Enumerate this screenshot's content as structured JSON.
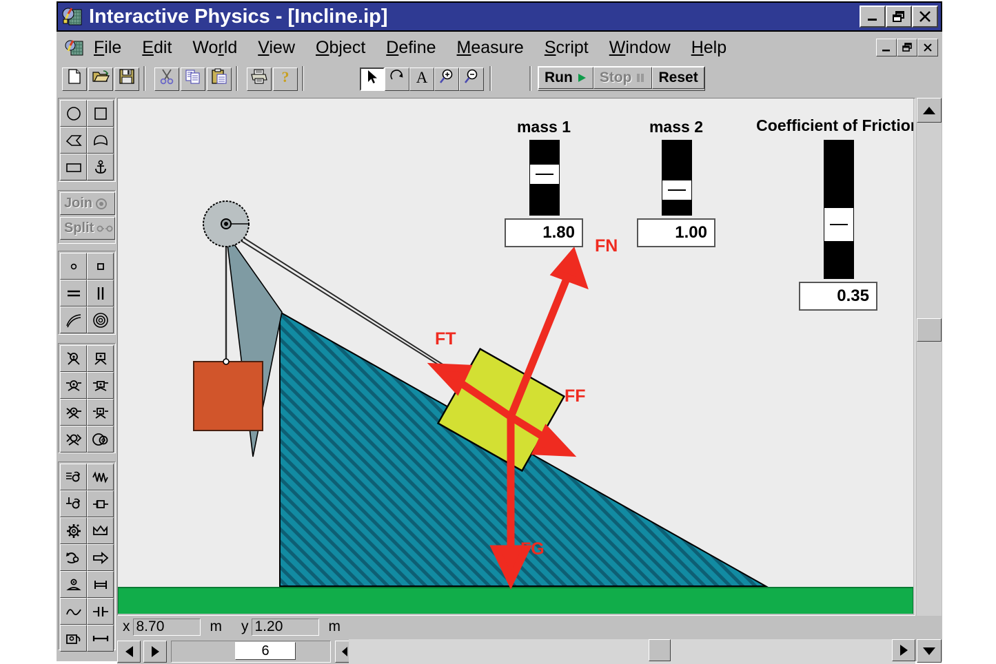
{
  "window": {
    "title": "Interactive Physics - [Incline.ip]",
    "app_icon": "physics-app-icon",
    "buttons": {
      "minimize": "_",
      "restore": "❐",
      "close": "✕"
    }
  },
  "mdi": {
    "minimize": "_",
    "restore": "❐",
    "close": "✕"
  },
  "menu": [
    {
      "label": "File",
      "accel": "F"
    },
    {
      "label": "Edit",
      "accel": "E"
    },
    {
      "label": "World",
      "accel": "r"
    },
    {
      "label": "View",
      "accel": "V"
    },
    {
      "label": "Object",
      "accel": "O"
    },
    {
      "label": "Define",
      "accel": "D"
    },
    {
      "label": "Measure",
      "accel": "M"
    },
    {
      "label": "Script",
      "accel": "S"
    },
    {
      "label": "Window",
      "accel": "W"
    },
    {
      "label": "Help",
      "accel": "H"
    }
  ],
  "toolbar": {
    "file_group": [
      "new-icon",
      "open-icon",
      "save-icon"
    ],
    "edit_group": [
      "cut-icon",
      "copy-icon",
      "paste-icon"
    ],
    "print_group": [
      "print-icon",
      "help-icon"
    ],
    "mode_group": [
      "arrow-pointer-icon",
      "rotate-icon",
      "text-icon",
      "zoom-in-icon",
      "zoom-out-icon"
    ],
    "run_label": "Run",
    "stop_label": "Stop",
    "reset_label": "Reset",
    "run_state": "enabled",
    "stop_state": "disabled"
  },
  "palette": {
    "shapes": [
      "circle-tool-icon",
      "rectangle-tool-icon",
      "polygon-tool-icon",
      "curved-polygon-tool-icon",
      "square-body-tool-icon",
      "anchor-tool-icon"
    ],
    "join_label": "Join",
    "split_label": "Split",
    "constraints": [
      "point-element-icon",
      "square-element-icon",
      "rod-icon",
      "rope-icon",
      "spring-curve-icon",
      "pulley-icon"
    ],
    "joints": [
      "pin-joint-icon",
      "rigid-joint-icon",
      "slot-joint-icon",
      "keyed-slot-joint-icon",
      "pin-slot-icon",
      "curved-slot-icon",
      "slot-rigid-icon",
      "gear-mesh-icon"
    ],
    "forces": [
      "damper-icon",
      "spring-zigzag-icon",
      "rotational-damper-icon",
      "actuator-icon",
      "motor-icon",
      "separator-icon",
      "force-curve-icon",
      "force-arrow-icon",
      "torque-icon",
      "rod-constraint-icon",
      "wave-icon",
      "capacitor-icon",
      "meter-icon",
      "ruler-icon"
    ]
  },
  "simulation": {
    "controls": [
      {
        "name": "mass 1",
        "value": "1.80",
        "fill_ratio": 0.4
      },
      {
        "name": "mass 2",
        "value": "1.00",
        "fill_ratio": 0.7
      },
      {
        "name": "Coefficient of Friction",
        "value": "0.35",
        "fill_ratio": 0.52
      }
    ],
    "force_labels": [
      {
        "id": "FN",
        "text": "FN"
      },
      {
        "id": "FT",
        "text": "FT"
      },
      {
        "id": "FF",
        "text": "FF"
      },
      {
        "id": "FG",
        "text": "FG"
      }
    ],
    "colors": {
      "incline": "#128ba2",
      "ground": "#11ad4a",
      "block": "#d3e033",
      "hanging_mass": "#d1552b",
      "force_arrow": "#ef2b20",
      "pulley": "#b9c0c2",
      "canvas": "#ececec"
    }
  },
  "status": {
    "x_label": "x",
    "x_value": "8.70",
    "x_unit": "m",
    "y_label": "y",
    "y_value": "1.20",
    "y_unit": "m"
  },
  "tape": {
    "frame": "6",
    "prev_icon": "step-back-icon",
    "next_icon": "step-forward-icon",
    "frame_back_icon": "frame-back-icon",
    "frame_fwd_icon": "frame-forward-icon",
    "rewind_icon": "rewind-icon"
  },
  "scrollbars": {
    "v_up_icon": "scroll-up-icon",
    "v_down_icon": "scroll-down-icon",
    "h_right_icon": "scroll-right-icon"
  }
}
